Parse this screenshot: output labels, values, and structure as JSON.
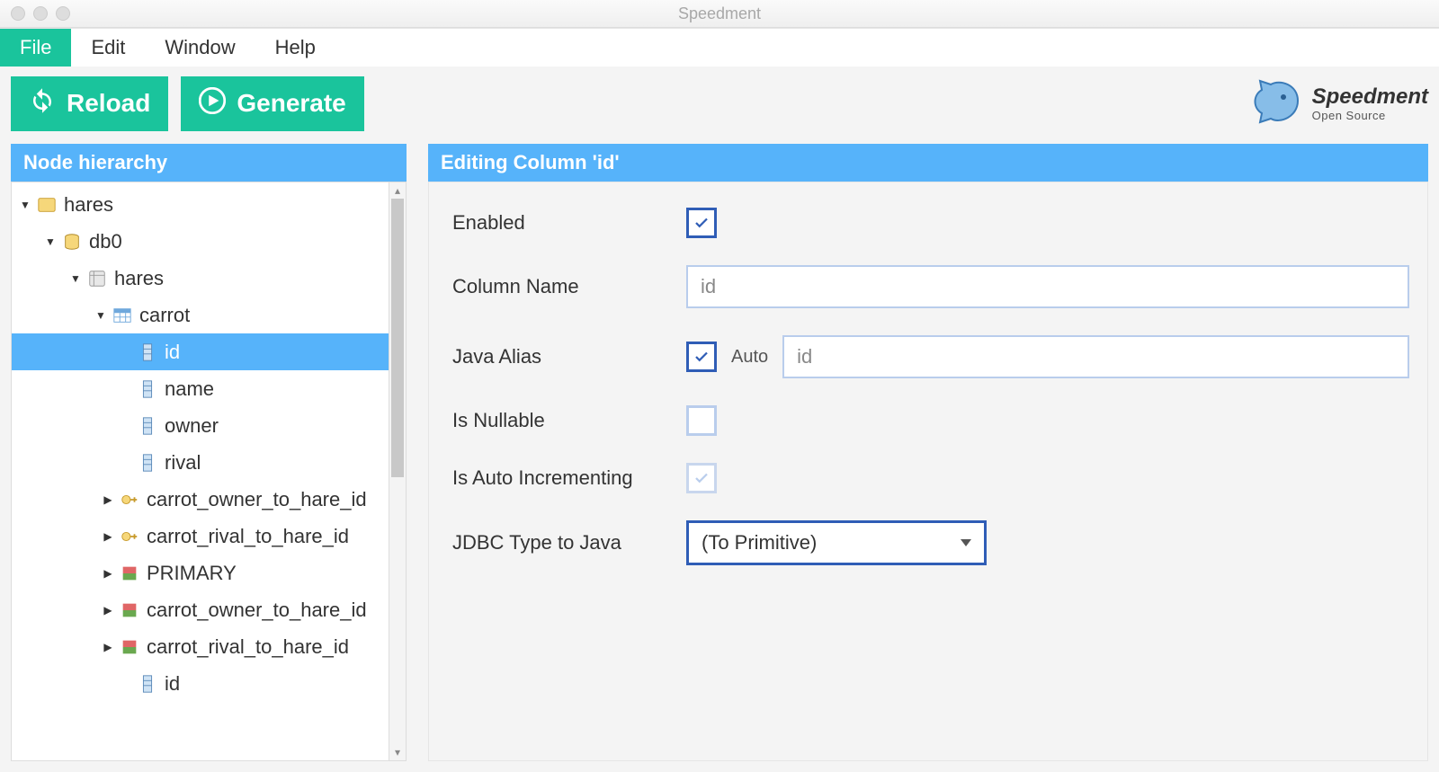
{
  "window": {
    "title": "Speedment"
  },
  "menubar": {
    "file": "File",
    "edit": "Edit",
    "window": "Window",
    "help": "Help"
  },
  "toolbar": {
    "reload": "Reload",
    "generate": "Generate"
  },
  "brand": {
    "name": "Speedment",
    "edition": "Open Source"
  },
  "side": {
    "title": "Node hierarchy",
    "tree": {
      "project": "hares",
      "database": "db0",
      "schema": "hares",
      "table": "carrot",
      "columns": [
        "id",
        "name",
        "owner",
        "rival"
      ],
      "fk1": "carrot_owner_to_hare_id",
      "fk2": "carrot_rival_to_hare_id",
      "idx_primary": "PRIMARY",
      "idx1": "carrot_owner_to_hare_id",
      "idx2": "carrot_rival_to_hare_id",
      "extra_col": "id"
    },
    "selected": "id"
  },
  "editor": {
    "title": "Editing Column 'id'",
    "fields": {
      "enabled": {
        "label": "Enabled",
        "value": true
      },
      "column_name": {
        "label": "Column Name",
        "value": "id"
      },
      "java_alias": {
        "label": "Java Alias",
        "auto_label": "Auto",
        "auto": true,
        "value": "id"
      },
      "is_nullable": {
        "label": "Is Nullable",
        "value": false
      },
      "is_auto_inc": {
        "label": "Is Auto Incrementing",
        "value": true,
        "disabled": true
      },
      "jdbc_type": {
        "label": "JDBC Type to Java",
        "value": "(To Primitive)"
      }
    }
  }
}
